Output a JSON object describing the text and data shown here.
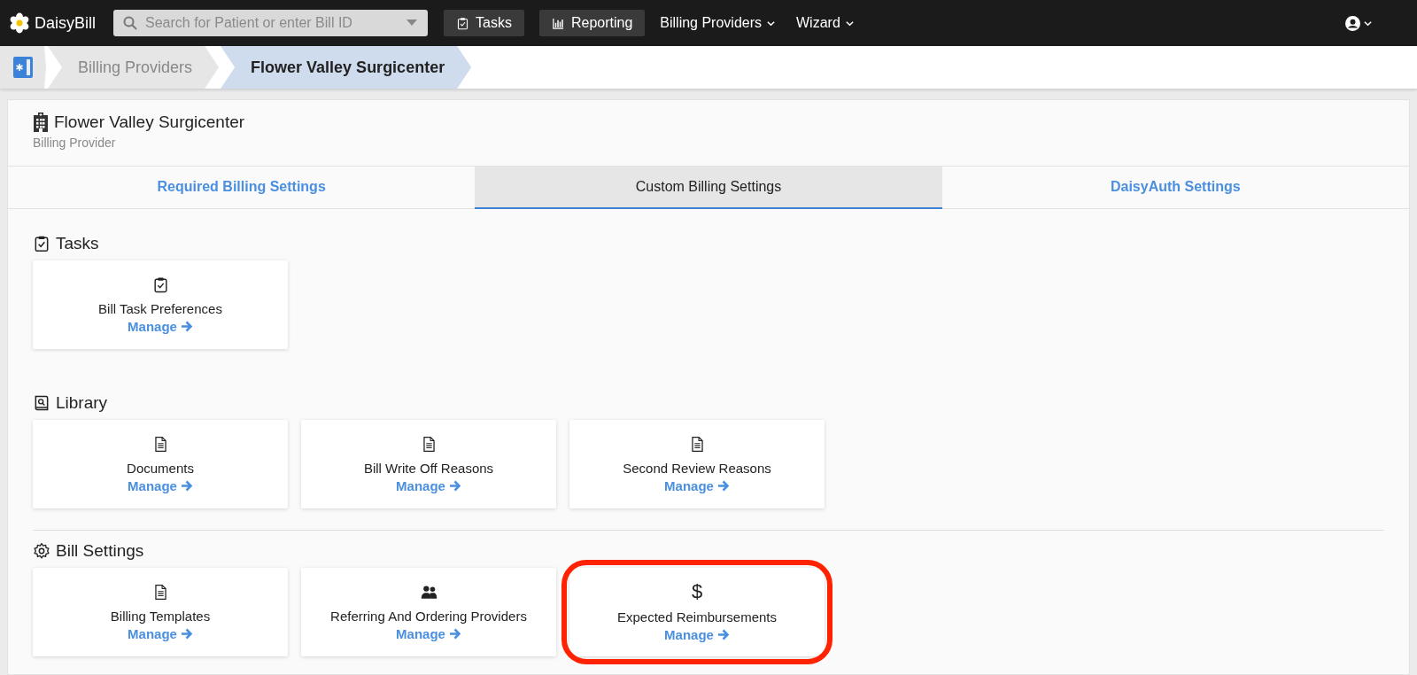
{
  "topbar": {
    "logo": "DaisyBill",
    "search": {
      "placeholder": "Search for Patient or enter Bill ID"
    },
    "buttons": [
      {
        "label": "Tasks",
        "kind": "clipboard"
      },
      {
        "label": "Reporting",
        "kind": "chart"
      }
    ],
    "menus": [
      "Billing Providers",
      "Wizard"
    ]
  },
  "breadcrumb": [
    {
      "label": "Billing Providers",
      "selected": false
    },
    {
      "label": "Flower Valley Surgicenter",
      "selected": true
    }
  ],
  "header": {
    "title": "Flower Valley Surgicenter",
    "subtitle": "Billing Provider"
  },
  "tabs": [
    {
      "label": "Required Billing Settings",
      "selected": false
    },
    {
      "label": "Custom Billing Settings",
      "selected": true
    },
    {
      "label": "DaisyAuth Settings",
      "selected": false
    }
  ],
  "sections": [
    {
      "title": "Tasks",
      "kind": "clipboard",
      "cards": [
        {
          "title": "Bill Task Preferences",
          "kind": "clipboard",
          "link": "Manage",
          "highlighted": false
        }
      ]
    },
    {
      "title": "Library",
      "kind": "book",
      "cards": [
        {
          "title": "Documents",
          "kind": "document",
          "link": "Manage",
          "highlighted": false
        },
        {
          "title": "Bill Write Off Reasons",
          "kind": "document",
          "link": "Manage",
          "highlighted": false
        },
        {
          "title": "Second Review Reasons",
          "kind": "document",
          "link": "Manage",
          "highlighted": false
        }
      ]
    },
    {
      "title": "Bill Settings",
      "kind": "gear",
      "cards": [
        {
          "title": "Billing Templates",
          "kind": "document",
          "link": "Manage",
          "highlighted": false
        },
        {
          "title": "Referring And Ordering Providers",
          "kind": "people",
          "link": "Manage",
          "highlighted": false
        },
        {
          "title": "Expected Reimbursements",
          "kind": "glyph",
          "glyph": "$",
          "link": "Manage",
          "highlighted": true
        }
      ]
    }
  ]
}
